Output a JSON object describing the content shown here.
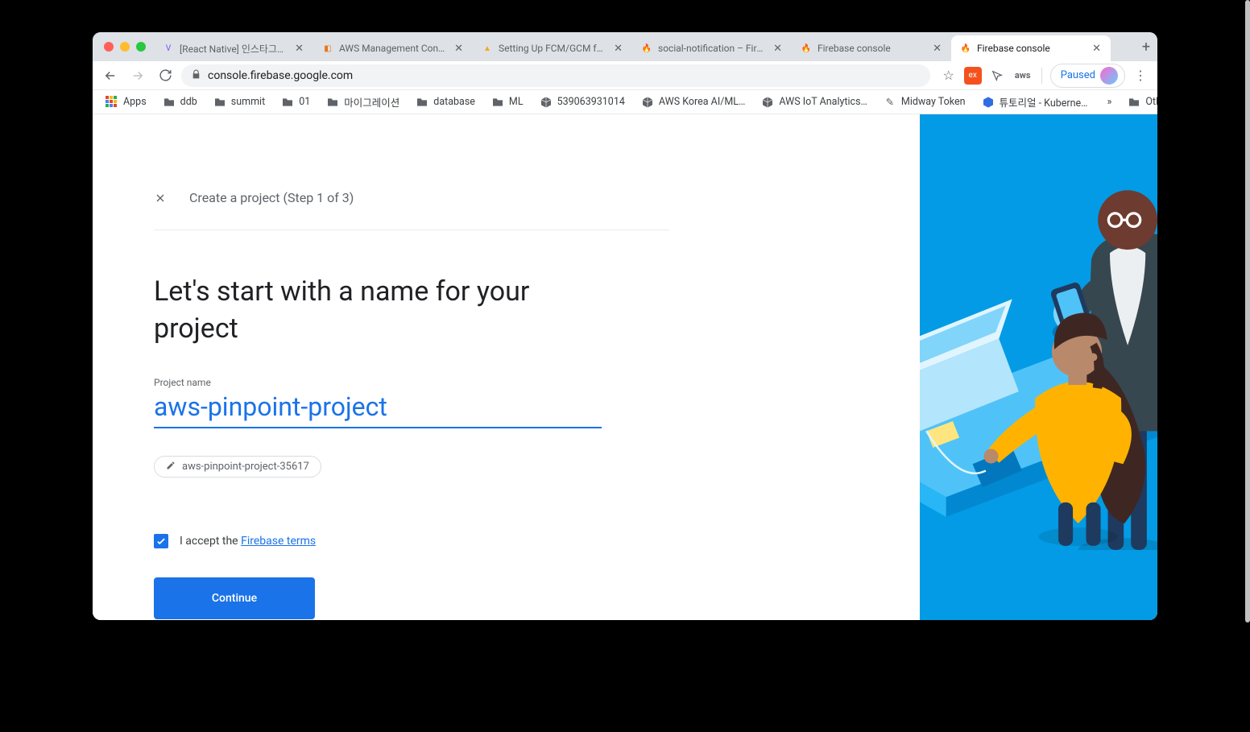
{
  "window": {
    "traffic": [
      "close",
      "minimize",
      "zoom"
    ]
  },
  "tabs": [
    {
      "favicon": "V",
      "favcolor": "#7c4dff",
      "title": "[React Native] 인스타그램 U"
    },
    {
      "favicon": "◧",
      "favcolor": "#ec7211",
      "title": "AWS Management Consol"
    },
    {
      "favicon": "▲",
      "favcolor": "#f5a623",
      "title": "Setting Up FCM/GCM for F"
    },
    {
      "favicon": "🔥",
      "favcolor": "#ffca28",
      "title": "social-notification – Fireb"
    },
    {
      "favicon": "🔥",
      "favcolor": "#ffca28",
      "title": "Firebase console"
    },
    {
      "favicon": "🔥",
      "favcolor": "#ffca28",
      "title": "Firebase console",
      "active": true
    }
  ],
  "newtab": "+",
  "toolbar": {
    "back": "←",
    "forward": "→",
    "reload": "↻",
    "lock": "🔒",
    "url": "console.firebase.google.com",
    "star": "☆",
    "ext1": {
      "label": "ex",
      "bg": "#f4511e"
    },
    "paused_label": "Paused",
    "menu": "⋮"
  },
  "bookmarks": {
    "apps": "Apps",
    "items": [
      {
        "type": "folder",
        "label": "ddb"
      },
      {
        "type": "folder",
        "label": "summit"
      },
      {
        "type": "folder",
        "label": "01"
      },
      {
        "type": "folder",
        "label": "마이그레이션"
      },
      {
        "type": "folder",
        "label": "database"
      },
      {
        "type": "folder",
        "label": "ML"
      },
      {
        "type": "aws",
        "label": "539063931014"
      },
      {
        "type": "aws",
        "label": "AWS Korea AI/ML…"
      },
      {
        "type": "aws",
        "label": "AWS IoT Analytics…"
      },
      {
        "type": "link",
        "label": "Midway Token",
        "icon": "✎"
      },
      {
        "type": "kube",
        "label": "튜토리얼 - Kuberne…"
      }
    ],
    "overflow": "»",
    "other": "Other Bookmarks"
  },
  "page": {
    "step_title": "Create a project (Step 1 of 3)",
    "heading": "Let's start with a name for your project",
    "field_label": "Project name",
    "project_name": "aws-pinpoint-project",
    "project_id": "aws-pinpoint-project-35617",
    "accept_prefix": "I accept the ",
    "accept_link": "Firebase terms",
    "continue": "Continue",
    "checkbox_checked": true
  }
}
